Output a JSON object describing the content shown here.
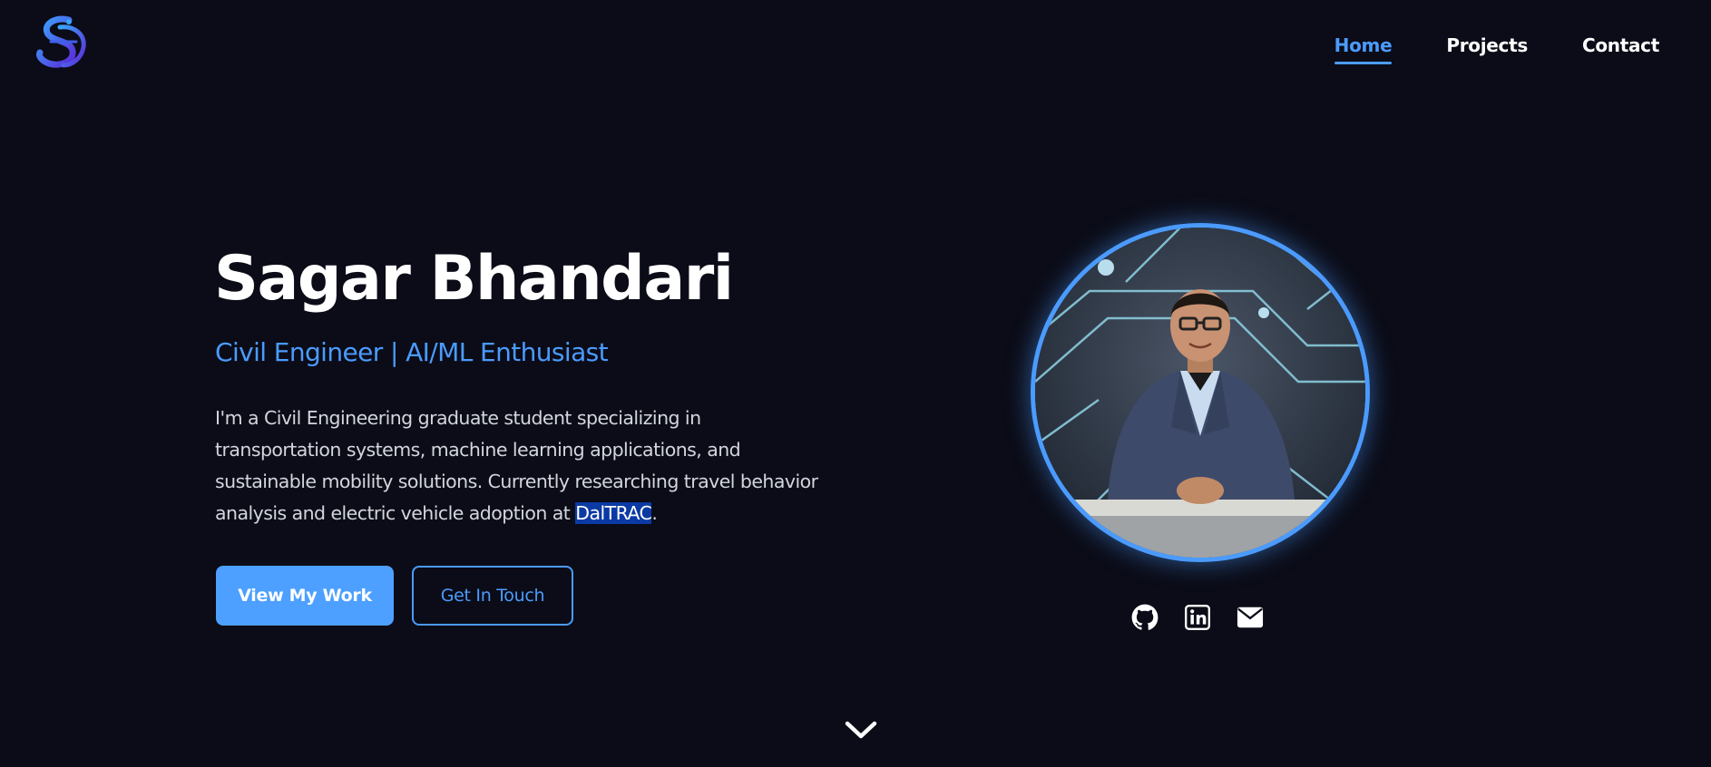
{
  "header": {
    "logo_icon": "monogram-s-logo-icon",
    "nav": [
      {
        "label": "Home",
        "active": true
      },
      {
        "label": "Projects",
        "active": false
      },
      {
        "label": "Contact",
        "active": false
      }
    ]
  },
  "hero": {
    "name": "Sagar Bhandari",
    "tagline": "Civil Engineer | AI/ML Enthusiast",
    "description_before": "I'm a Civil Engineering graduate student specializing in transportation systems, machine learning applications, and sustainable mobility solutions. Currently researching travel behavior analysis and electric vehicle adoption at ",
    "description_highlight": "DalTRAC",
    "description_after": ".",
    "primary_button": "View My Work",
    "secondary_button": "Get In Touch"
  },
  "profile": {
    "photo": "profile-photo",
    "social_icons": [
      "github-icon",
      "linkedin-icon",
      "mail-icon"
    ]
  },
  "scroll_icon": "chevron-down-icon",
  "colors": {
    "background": "#0b0c17",
    "accent": "#4b9bff",
    "text": "#ffffff",
    "body_text": "#d3d6dd",
    "highlight": "#0b3aa4"
  }
}
